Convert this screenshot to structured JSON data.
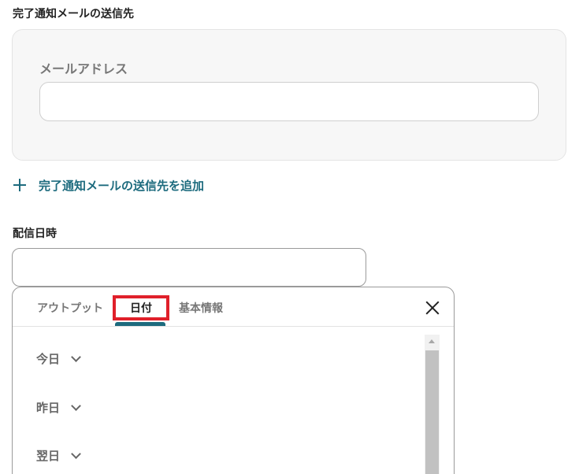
{
  "notify": {
    "title": "完了通知メールの送信先",
    "email_label": "メールアドレス",
    "email_value": "",
    "add_label": "完了通知メールの送信先を追加"
  },
  "delivery": {
    "title": "配信日時",
    "value": ""
  },
  "popover": {
    "tabs": [
      {
        "label": "アウトプット",
        "active": false
      },
      {
        "label": "日付",
        "active": true
      },
      {
        "label": "基本情報",
        "active": false
      }
    ],
    "items": [
      {
        "label": "今日"
      },
      {
        "label": "昨日"
      },
      {
        "label": "翌日"
      }
    ]
  },
  "colors": {
    "accent": "#1d6b7e",
    "highlight": "#e0202a"
  }
}
